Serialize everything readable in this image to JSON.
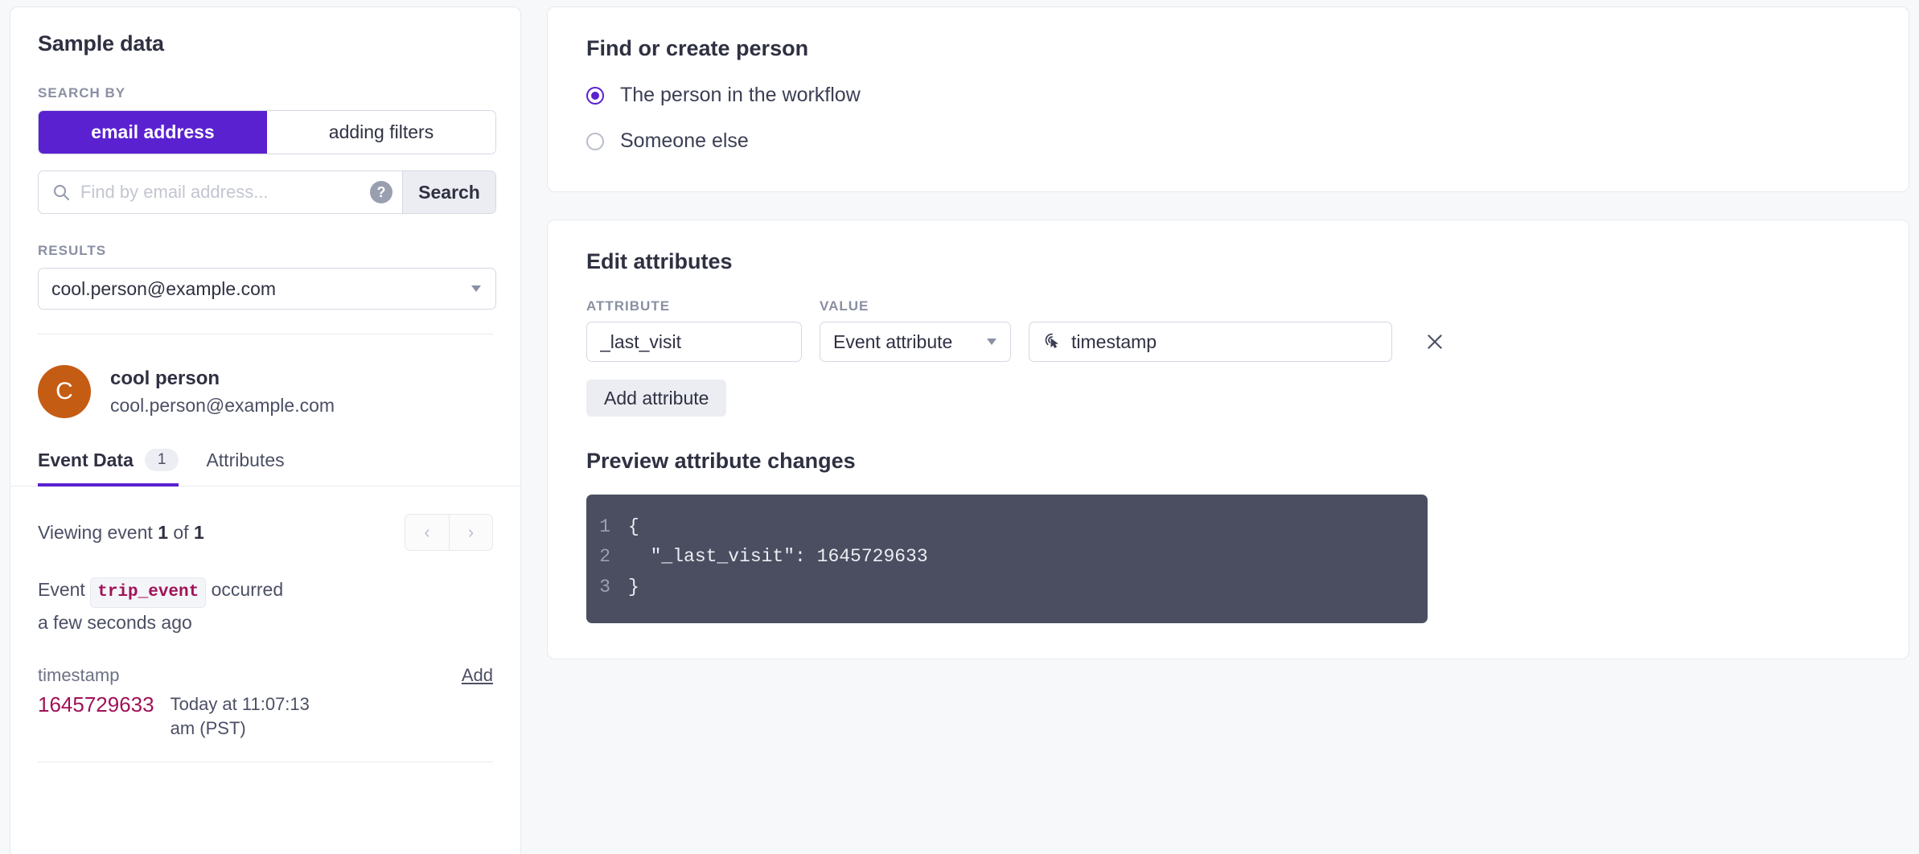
{
  "left_panel": {
    "title": "Sample data",
    "search_by_label": "SEARCH BY",
    "segments": [
      {
        "label": "email address",
        "active": true
      },
      {
        "label": "adding filters",
        "active": false
      }
    ],
    "search": {
      "placeholder": "Find by email address...",
      "value": "",
      "help_icon": "question-mark-icon",
      "search_icon": "magnifier-icon",
      "button_label": "Search"
    },
    "results_label": "RESULTS",
    "results_selected": "cool.person@example.com",
    "person": {
      "avatar_initial": "C",
      "avatar_color": "#c55c13",
      "name": "cool person",
      "email": "cool.person@example.com"
    },
    "tabs": [
      {
        "label": "Event Data",
        "badge": "1",
        "active": true
      },
      {
        "label": "Attributes",
        "badge": "",
        "active": false
      }
    ],
    "viewing": {
      "prefix": "Viewing event",
      "current": "1",
      "middle": "of",
      "total": "1",
      "prev_icon": "chevron-left-icon",
      "next_icon": "chevron-right-icon"
    },
    "event_description": {
      "before": "Event",
      "name": "trip_event",
      "after": "occurred",
      "when": "a few seconds ago"
    },
    "attribute_row": {
      "key": "timestamp",
      "add_label": "Add",
      "value": "1645729633",
      "human_value": "Today at 11:07:13 am (PST)"
    }
  },
  "find_person": {
    "title": "Find or create person",
    "options": [
      {
        "label": "The person in the workflow",
        "selected": true
      },
      {
        "label": "Someone else",
        "selected": false
      }
    ]
  },
  "edit_attributes": {
    "title": "Edit attributes",
    "attribute_label": "ATTRIBUTE",
    "value_label": "VALUE",
    "rows": [
      {
        "attribute": "_last_visit",
        "value_type": "Event attribute",
        "value": "timestamp",
        "value_icon": "click-target-icon",
        "remove_icon": "close-icon"
      }
    ],
    "add_attribute_label": "Add attribute",
    "preview_title": "Preview attribute changes",
    "preview_code": [
      {
        "n": "1",
        "text": "{"
      },
      {
        "n": "2",
        "text": "  \"_last_visit\": 1645729633"
      },
      {
        "n": "3",
        "text": "}"
      }
    ]
  },
  "colors": {
    "accent_purple": "#5a21d0",
    "avatar_orange": "#c55c13",
    "code_bg": "#4b4e61",
    "magenta": "#a01257",
    "page_bg": "#f7f8fa"
  }
}
